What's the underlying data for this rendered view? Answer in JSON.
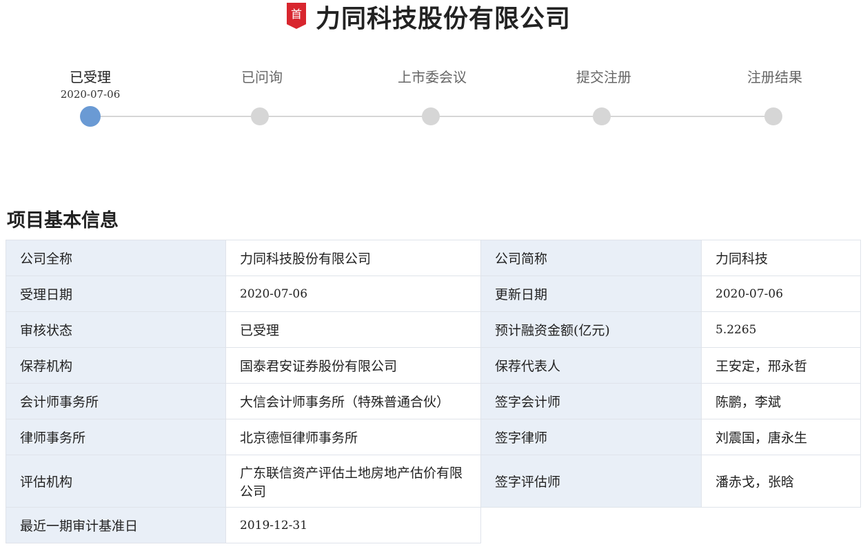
{
  "header": {
    "badge": "首",
    "title": "力同科技股份有限公司"
  },
  "progress": {
    "steps": [
      {
        "label": "已受理",
        "date": "2020-07-06",
        "active": true
      },
      {
        "label": "已问询",
        "date": "",
        "active": false
      },
      {
        "label": "上市委会议",
        "date": "",
        "active": false
      },
      {
        "label": "提交注册",
        "date": "",
        "active": false
      },
      {
        "label": "注册结果",
        "date": "",
        "active": false
      }
    ]
  },
  "section": {
    "title": "项目基本信息"
  },
  "info": {
    "rows": [
      {
        "k1": "公司全称",
        "v1": "力同科技股份有限公司",
        "k2": "公司简称",
        "v2": "力同科技"
      },
      {
        "k1": "受理日期",
        "v1": "2020-07-06",
        "k2": "更新日期",
        "v2": "2020-07-06"
      },
      {
        "k1": "审核状态",
        "v1": "已受理",
        "k2": "预计融资金额(亿元)",
        "v2": "5.2265"
      },
      {
        "k1": "保荐机构",
        "v1": "国泰君安证券股份有限公司",
        "k2": "保荐代表人",
        "v2": "王安定，邢永哲"
      },
      {
        "k1": "会计师事务所",
        "v1": "大信会计师事务所（特殊普通合伙）",
        "k2": "签字会计师",
        "v2": "陈鹏，李斌"
      },
      {
        "k1": "律师事务所",
        "v1": "北京德恒律师事务所",
        "k2": "签字律师",
        "v2": "刘震国，唐永生"
      },
      {
        "k1": "评估机构",
        "v1": "广东联信资产评估土地房地产估价有限公司",
        "k2": "签字评估师",
        "v2": "潘赤戈，张晗"
      },
      {
        "k1": "最近一期审计基准日",
        "v1": "2019-12-31"
      }
    ]
  },
  "colors": {
    "accent": "#6a9ad4",
    "link": "#3a6fb3",
    "badge": "#d8262e",
    "keyCell": "#e9eff7"
  }
}
